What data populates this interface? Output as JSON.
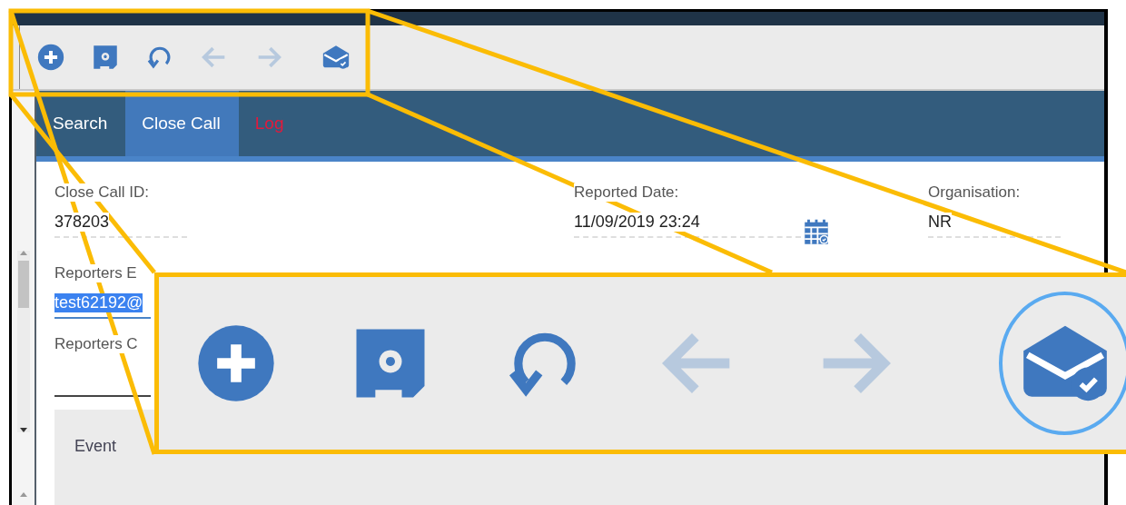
{
  "toolbar": {
    "buttons": [
      {
        "kind": "add",
        "disabled": false
      },
      {
        "kind": "save",
        "disabled": false
      },
      {
        "kind": "undo",
        "disabled": false
      },
      {
        "kind": "back",
        "disabled": true
      },
      {
        "kind": "forward",
        "disabled": true
      },
      {
        "kind": "mail",
        "disabled": false
      }
    ]
  },
  "tabs": [
    {
      "label": "Search",
      "selected": false,
      "alert": false
    },
    {
      "label": "Close Call",
      "selected": true,
      "alert": false
    },
    {
      "label": "Log",
      "selected": false,
      "alert": true
    }
  ],
  "form": {
    "rows": [
      [
        {
          "label": "Close Call ID:",
          "value": "378203",
          "kind": "readonly"
        },
        {
          "label": "Reported Date:",
          "value": "11/09/2019 23:24",
          "kind": "date"
        },
        {
          "label": "Organisation:",
          "value": "NR",
          "kind": "readonly"
        }
      ],
      [
        {
          "label": "Reporters E",
          "value": "test62192@",
          "kind": "input",
          "focused": true,
          "value_selected": true
        }
      ],
      [
        {
          "label": "Reporters C",
          "kind": "input",
          "focused": false
        }
      ]
    ]
  },
  "event_panel": {
    "title": "Event"
  },
  "callout": {
    "icons": [
      {
        "kind": "add",
        "disabled": false,
        "highlighted": false
      },
      {
        "kind": "save",
        "disabled": false,
        "highlighted": false
      },
      {
        "kind": "undo",
        "disabled": false,
        "highlighted": false
      },
      {
        "kind": "back",
        "disabled": true,
        "highlighted": false
      },
      {
        "kind": "forward",
        "disabled": true,
        "highlighted": false
      },
      {
        "kind": "mail",
        "disabled": false,
        "highlighted": true
      }
    ]
  }
}
